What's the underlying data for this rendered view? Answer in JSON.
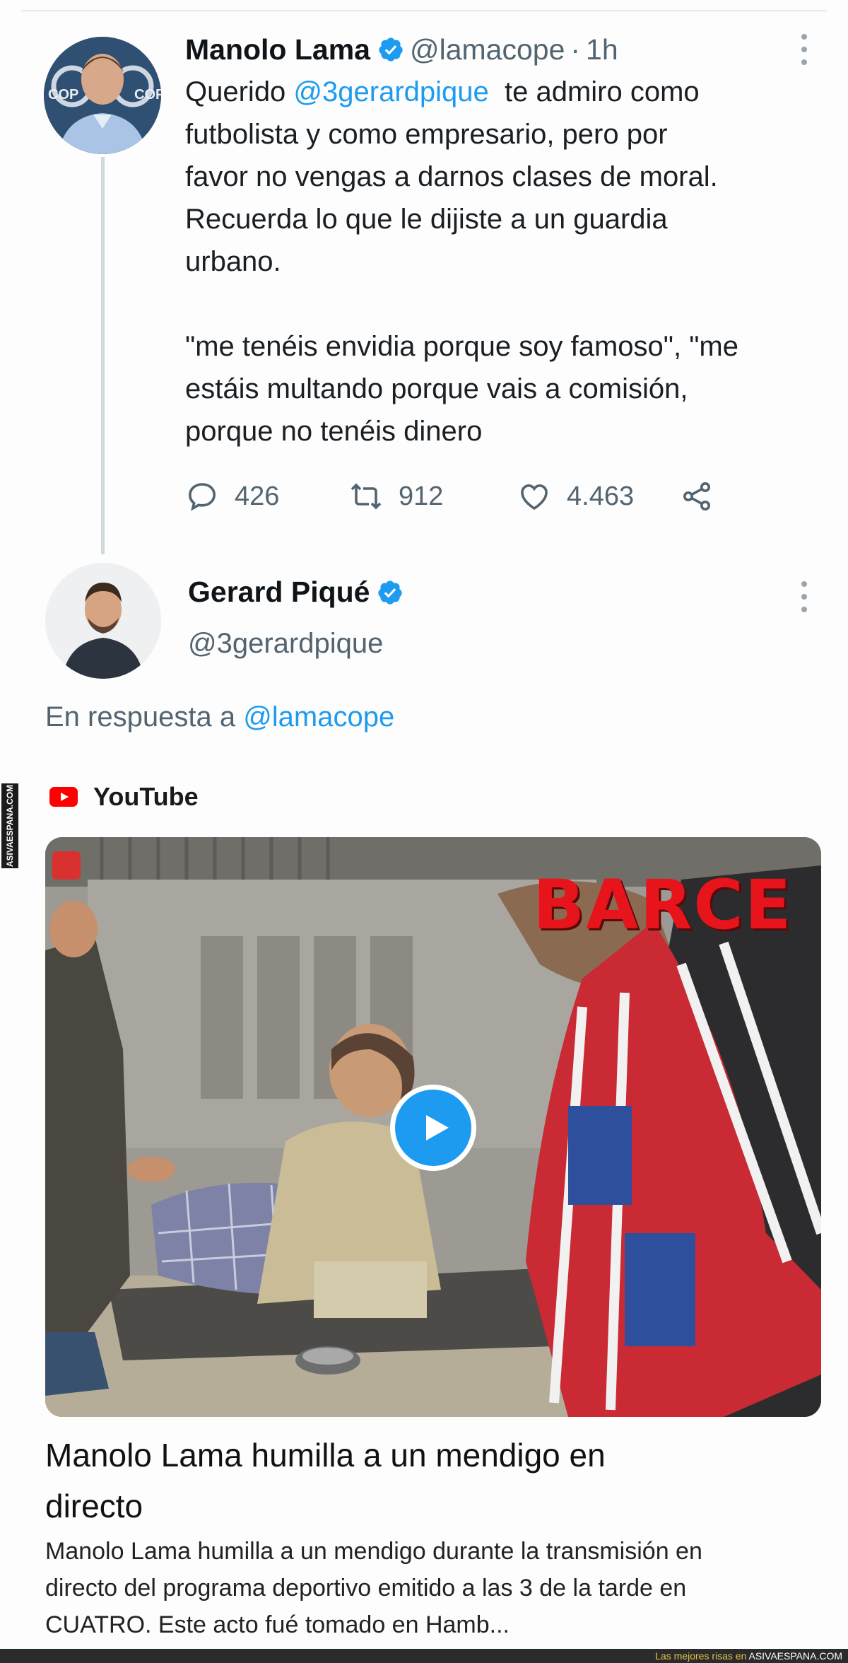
{
  "tweet1": {
    "author_name": "Manolo Lama",
    "handle": "@lamacope",
    "separator": "·",
    "time": "1h",
    "line1_pre": "Querido ",
    "line1_mention": "@3gerardpique",
    "line1_post": "  te admiro como",
    "line2": "futbolista y como empresario, pero por",
    "line3": "favor no vengas a darnos clases de moral.",
    "line4": "Recuerda lo que le dijiste a un guardia",
    "line5": "urbano.",
    "line6": "\"me tenéis envidia porque soy famoso\", \"me",
    "line7": "estáis multando porque vais a comisión,",
    "line8": "porque no tenéis dinero",
    "replies": "426",
    "retweets": "912",
    "likes": "4.463"
  },
  "tweet2": {
    "author_name": "Gerard Piqué",
    "handle": "@3gerardpique",
    "reply_prefix": "En respuesta a ",
    "reply_handle": "@lamacope"
  },
  "card": {
    "source": "YouTube",
    "overlay_text": "BARCE",
    "title_line1": "Manolo Lama humilla a un mendigo en",
    "title_line2": "directo",
    "desc_line1": "Manolo Lama humilla a un mendigo durante la transmisión en",
    "desc_line2": "directo del programa deportivo emitido a las 3 de la tarde en",
    "desc_line3": "CUATRO. Este acto fué tomado en Hamb..."
  },
  "watermark": {
    "side_text": "ASIVAESPANA.COM",
    "footer_prefix": "Las mejores risas en ",
    "footer_site": "ASIVAESPANA.COM"
  },
  "colors": {
    "link": "#1d9bf0",
    "verified": "#1d9bf0",
    "secondary_text": "#536471",
    "youtube_red": "#ff0000"
  }
}
